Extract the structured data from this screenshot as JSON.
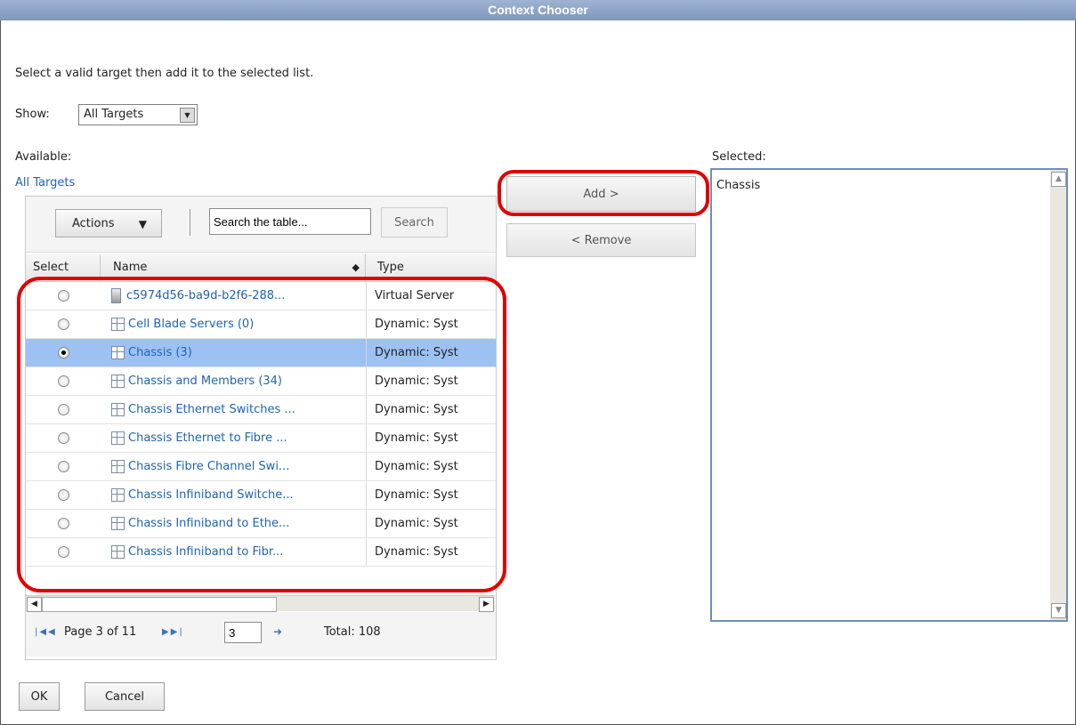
{
  "window": {
    "title": "Context Chooser"
  },
  "instruction": "Select a valid target then add it to the selected list.",
  "show": {
    "label": "Show:",
    "value": "All Targets"
  },
  "available": {
    "label": "Available:",
    "breadcrumb": "All Targets",
    "toolbar": {
      "actions_label": "Actions",
      "search_placeholder": "Search the table...",
      "search_label": "Search"
    },
    "columns": {
      "select": "Select",
      "name": "Name",
      "type": "Type"
    },
    "rows": [
      {
        "name": "c5974d56-ba9d-b2f6-288...",
        "type": "Virtual Server",
        "icon": "server",
        "selected": false
      },
      {
        "name": "Cell Blade Servers (0)",
        "type": "Dynamic: Syst",
        "icon": "group",
        "selected": false
      },
      {
        "name": "Chassis (3)",
        "type": "Dynamic: Syst",
        "icon": "group",
        "selected": true
      },
      {
        "name": "Chassis and Members (34)",
        "type": "Dynamic: Syst",
        "icon": "group",
        "selected": false
      },
      {
        "name": "Chassis Ethernet Switches ...",
        "type": "Dynamic: Syst",
        "icon": "group",
        "selected": false
      },
      {
        "name": "Chassis Ethernet to Fibre ...",
        "type": "Dynamic: Syst",
        "icon": "group",
        "selected": false
      },
      {
        "name": "Chassis Fibre Channel Swi...",
        "type": "Dynamic: Syst",
        "icon": "group",
        "selected": false
      },
      {
        "name": "Chassis Infiniband Switche...",
        "type": "Dynamic: Syst",
        "icon": "group",
        "selected": false
      },
      {
        "name": "Chassis Infiniband to Ethe...",
        "type": "Dynamic: Syst",
        "icon": "group",
        "selected": false
      },
      {
        "name": "Chassis Infiniband to Fibr...",
        "type": "Dynamic: Syst",
        "icon": "group",
        "selected": false
      }
    ],
    "pager": {
      "page_text": "Page 3 of 11",
      "page_input": "3",
      "total_text": "Total: 108"
    }
  },
  "buttons": {
    "add": "Add >",
    "remove": "< Remove",
    "ok": "OK",
    "cancel": "Cancel"
  },
  "selected": {
    "label": "Selected:",
    "items": [
      "Chassis"
    ]
  },
  "colors": {
    "title_bar": "#8aa2c8",
    "selection": "#9dc1f3",
    "highlight": "#e00000",
    "link": "#1f63b5"
  }
}
